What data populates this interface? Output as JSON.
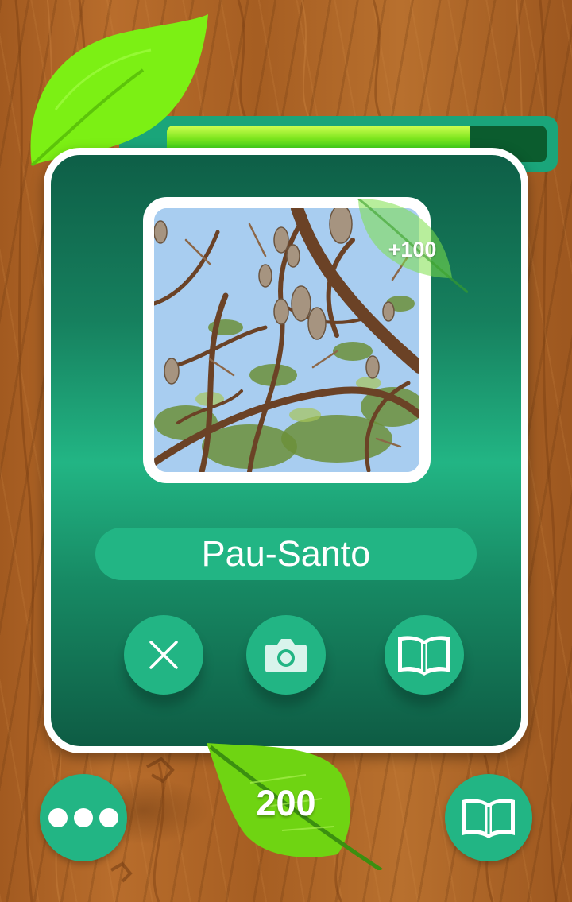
{
  "progress": {
    "fraction": 0.8
  },
  "card": {
    "bonus_label": "+100",
    "species_name": "Pau-Santo",
    "actions": [
      {
        "icon": "close-icon"
      },
      {
        "icon": "camera-icon"
      },
      {
        "icon": "book-icon"
      }
    ]
  },
  "footer": {
    "score": "200",
    "menu_icon": "more-dots-icon",
    "guide_icon": "book-icon"
  },
  "colors": {
    "accent": "#22b584",
    "card_dark": "#0e5f47",
    "progress_fill": "#7fe61f",
    "leaf": "#6fd412"
  }
}
